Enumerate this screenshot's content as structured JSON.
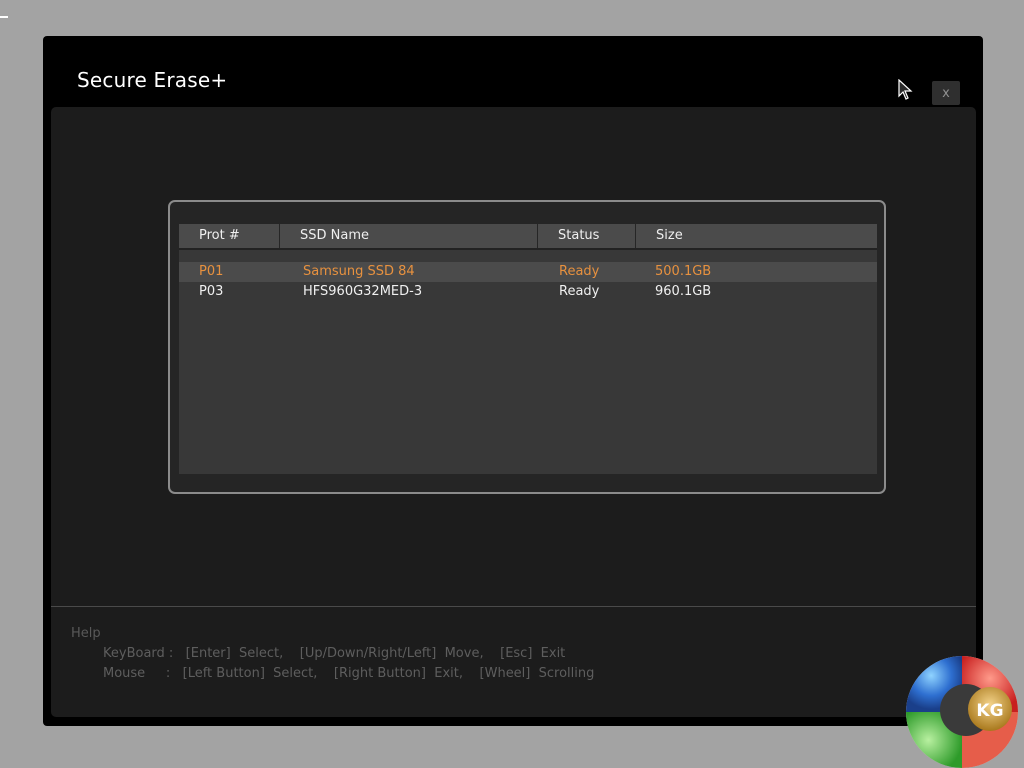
{
  "window": {
    "title": "Secure Erase+",
    "close_label": "x"
  },
  "table": {
    "headers": [
      "Prot #",
      "SSD Name",
      "Status",
      "Size"
    ],
    "rows": [
      {
        "port": "P01",
        "name": "Samsung SSD 84",
        "status": "Ready",
        "size": "500.1GB",
        "selected": true
      },
      {
        "port": "P03",
        "name": "HFS960G32MED-3",
        "status": "Ready",
        "size": "960.1GB",
        "selected": false
      }
    ]
  },
  "help": {
    "title": "Help",
    "keyboard": "KeyBoard :   [Enter]  Select,    [Up/Down/Right/Left]  Move,    [Esc]  Exit",
    "mouse": "Mouse     :   [Left Button]  Select,    [Right Button]  Exit,    [Wheel]  Scrolling"
  },
  "colors": {
    "selected_text": "#e7913f",
    "window_bg": "#000000",
    "content_bg": "#1c1c1c",
    "desktop_bg": "#a3a3a3"
  },
  "logo": {
    "text": "KG"
  }
}
